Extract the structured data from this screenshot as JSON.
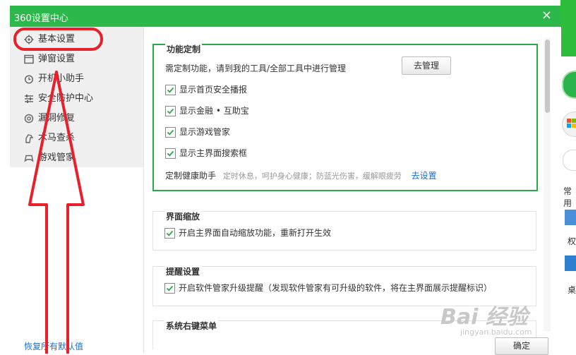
{
  "window": {
    "title": "360设置中心",
    "close_glyph": "×"
  },
  "sidebar": {
    "items": [
      {
        "label": "基本设置",
        "icon": "gear-icon"
      },
      {
        "label": "弹窗设置",
        "icon": "window-icon"
      },
      {
        "label": "开机小助手",
        "icon": "clock-icon"
      },
      {
        "label": "安全防护中心",
        "icon": "equalizer-icon"
      },
      {
        "label": "漏洞修复",
        "icon": "bug-icon"
      },
      {
        "label": "木马查杀",
        "icon": "horse-icon"
      },
      {
        "label": "游戏管家",
        "icon": "gamepad-icon"
      }
    ],
    "restore_label": "恢复所有默认值"
  },
  "sections": {
    "custom": {
      "title": "功能定制",
      "desc": "需定制功能，请到我的工具/全部工具中进行管理",
      "manage_button": "去管理",
      "checkboxes": [
        {
          "label": "显示首页安全播报",
          "checked": true
        },
        {
          "label": "显示金融 • 互助宝",
          "checked": true
        },
        {
          "label": "显示游戏管家",
          "checked": true
        },
        {
          "label": "显示主界面搜索框",
          "checked": true
        }
      ],
      "health_label": "定制健康助手",
      "health_hint": "定时休息，呵护身心健康；防蓝光伤害，缓解眼疲劳",
      "health_link": "去设置"
    },
    "zoom": {
      "title": "界面缩放",
      "checkbox": {
        "label": "开启主界面自动缩放功能，重新打开生效",
        "checked": true
      }
    },
    "reminder": {
      "title": "提醒设置",
      "checkbox": {
        "label": "开启软件管家升级提醒（发现软件管家有可升级的软件，将在主界面展示提醒标识）",
        "checked": true
      }
    },
    "context_menu": {
      "title": "系统右键菜单"
    }
  },
  "footer": {
    "ok_button": "确定"
  },
  "background_app": {
    "label_1": "常用",
    "label_2": "权",
    "label_3": "桌"
  },
  "watermark": {
    "main": "Bai 经验",
    "sub": "jingyan.baidu.com"
  },
  "colors": {
    "accent": "#2cb84a",
    "annotation": "#e8202a",
    "link": "#1a6fc9"
  }
}
